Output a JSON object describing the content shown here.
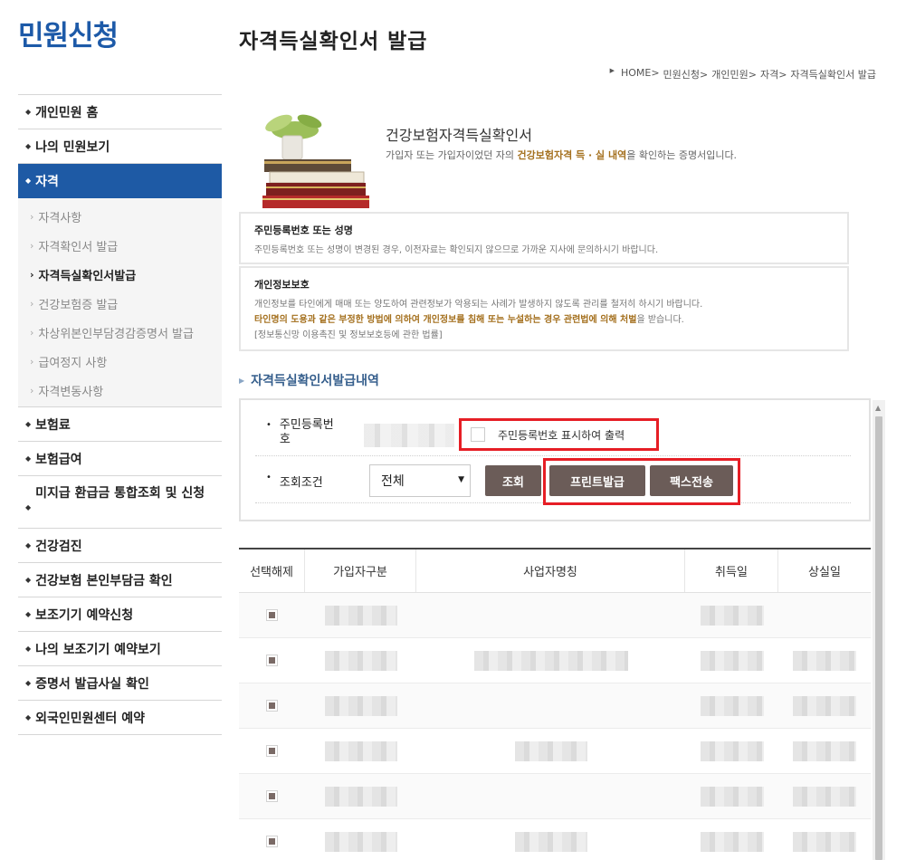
{
  "brand": "민원신청",
  "page_title": "자격득실확인서 발급",
  "breadcrumb": [
    "HOME>",
    "민원신청>",
    "개인민원>",
    "자격>",
    "자격득실확인서 발급"
  ],
  "sidebar": {
    "items": [
      {
        "label": "개인민원 홈"
      },
      {
        "label": "나의 민원보기"
      },
      {
        "label": "자격",
        "active": true
      },
      {
        "label": "보험료"
      },
      {
        "label": "보험급여"
      },
      {
        "label": "미지급 환급금 통합조회 및 신청"
      },
      {
        "label": "건강검진"
      },
      {
        "label": "건강보험 본인부담금 확인"
      },
      {
        "label": "보조기기 예약신청"
      },
      {
        "label": "나의 보조기기 예약보기"
      },
      {
        "label": "증명서 발급사실 확인"
      },
      {
        "label": "외국인민원센터 예약"
      }
    ],
    "sub_items": [
      {
        "label": "자격사항"
      },
      {
        "label": "자격확인서 발급"
      },
      {
        "label": "자격득실확인서발급",
        "current": true
      },
      {
        "label": "건강보험증 발급"
      },
      {
        "label": "차상위본인부담경감증명서 발급"
      },
      {
        "label": "급여정지 사항"
      },
      {
        "label": "자격변동사항"
      }
    ]
  },
  "intro": {
    "title": "건강보험자격득실확인서",
    "desc_pre": "가입자 또는 가입자이었던 자의 ",
    "desc_hl": "건강보험자격 득 · 실 내역",
    "desc_post": "을 확인하는 증명서입니다."
  },
  "notices": [
    {
      "title": "주민등록번호 또는 성명",
      "text": "주민등록번호 또는 성명이 변경된 경우, 이전자료는 확인되지 않으므로 가까운 지사에 문의하시기 바랍니다."
    },
    {
      "title": "개인정보보호",
      "text": "개인정보를 타인에게 매매 또는 양도하여 관련정보가 악용되는 사례가 발생하지 않도록 관리를 철저히 하시기 바랍니다.",
      "warn": "타인명의 도용과 같은 부정한 방법에 의하여 개인정보를 침해 또는 누설하는 경우 관련법에 의해 처벌",
      "warn_tail": "을 받습니다.",
      "law": "[정보통신망 이용촉진 및 정보보호등에 관한 법률]"
    }
  ],
  "section_title": "자격득실확인서발급내역",
  "search": {
    "rrn_label": "주민등록번호",
    "show_rrn_label": "주민등록번호 표시하여 출력",
    "condition_label": "조회조건",
    "condition_value": "전체",
    "search_button": "조회",
    "print_button": "프린트발급",
    "fax_button": "팩스전송"
  },
  "table": {
    "headers": [
      "선택해제",
      "가입자구분",
      "사업자명칭",
      "취득일",
      "상실일"
    ],
    "row_count": 6
  },
  "colors": {
    "brand": "#1d5aa8",
    "active_nav": "#1e5aa5",
    "button": "#6b5c58",
    "highlight": "#e61e25",
    "warn": "#a4701e"
  }
}
